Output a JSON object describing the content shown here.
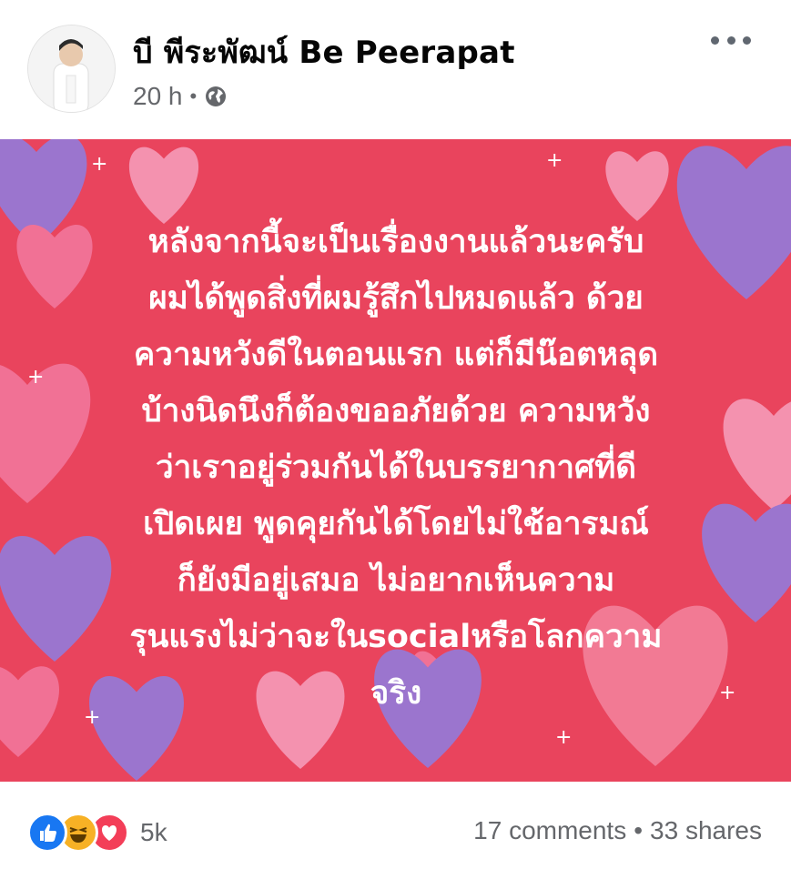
{
  "post": {
    "author": "บี พีระพัฒน์ Be Peerapat",
    "time": "20 h",
    "separator": "•",
    "privacy_icon": "globe-icon",
    "text": "หลังจากนี้จะเป็นเรื่องงานแล้วนะครับ\nผมได้พูดสิ่งที่ผมรู้สึกไปหมดแล้ว  ด้วย\nความหวังดีในตอนแรก แต่ก็มีน๊อตหลุด\nบ้างนิดนึงก็ต้องขออภัยด้วย ความหวัง\nว่าเราอยู่ร่วมกันได้ในบรรยากาศที่ดี\nเปิดเผย พูดคุยกันได้โดยไม่ใช้อารมณ์\nก็ยังมีอยู่เสมอ ไม่อยากเห็นความ\nรุนแรงไม่ว่าจะในsocialหรือโลกความ\nจริง",
    "background_colors": {
      "base": "#e9445d",
      "heart_pink": "#f27aa0",
      "heart_purple": "#8d7fe3"
    }
  },
  "footer": {
    "reaction_icons": [
      "like-icon",
      "haha-icon",
      "love-icon"
    ],
    "reaction_count": "5k",
    "comments": "17 comments",
    "separator": "•",
    "shares": "33 shares"
  },
  "colors": {
    "like": "#1877f2",
    "haha": "#f7b125",
    "love": "#f33e58",
    "meta_text": "#65676b"
  }
}
